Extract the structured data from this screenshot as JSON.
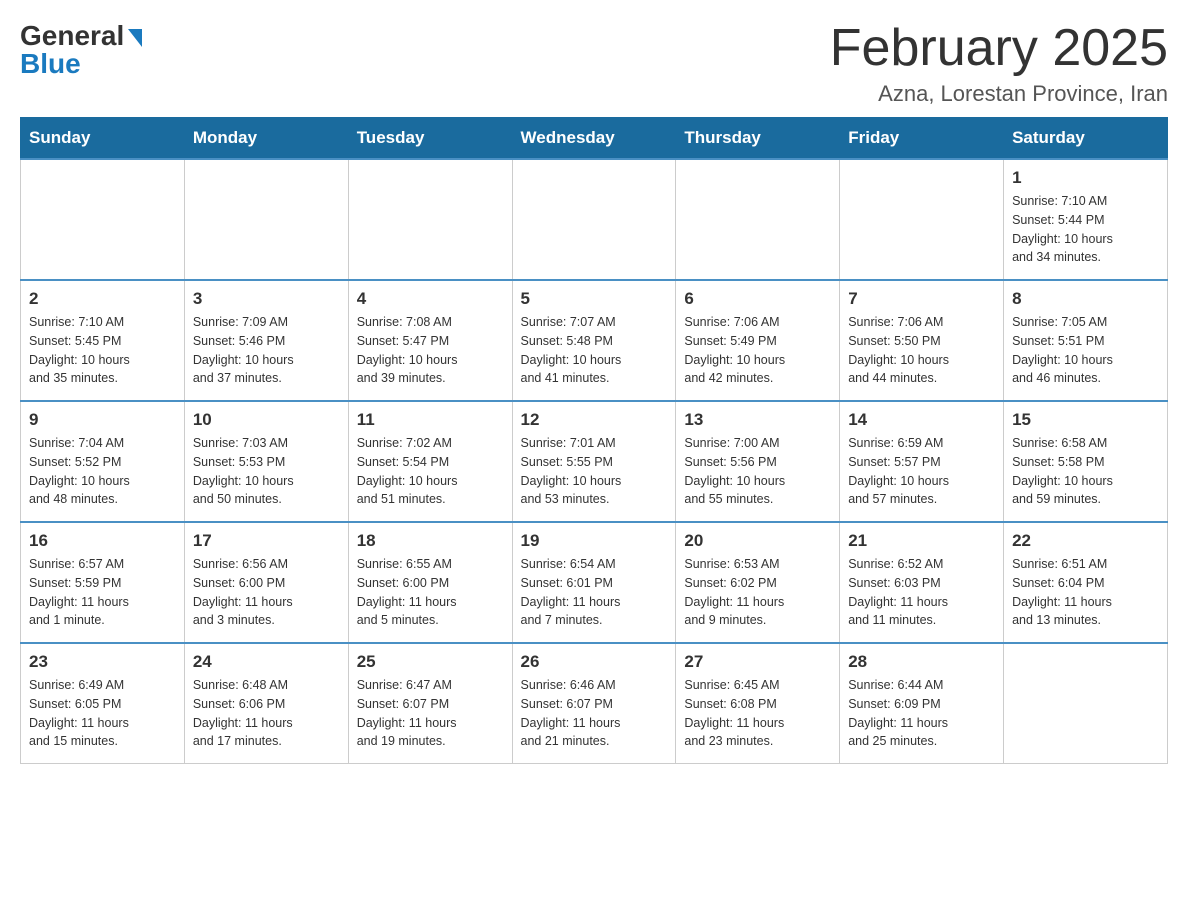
{
  "header": {
    "logo_general": "General",
    "logo_blue": "Blue",
    "month_title": "February 2025",
    "location": "Azna, Lorestan Province, Iran"
  },
  "days_of_week": [
    "Sunday",
    "Monday",
    "Tuesday",
    "Wednesday",
    "Thursday",
    "Friday",
    "Saturday"
  ],
  "weeks": [
    {
      "days": [
        {
          "number": "",
          "info": ""
        },
        {
          "number": "",
          "info": ""
        },
        {
          "number": "",
          "info": ""
        },
        {
          "number": "",
          "info": ""
        },
        {
          "number": "",
          "info": ""
        },
        {
          "number": "",
          "info": ""
        },
        {
          "number": "1",
          "info": "Sunrise: 7:10 AM\nSunset: 5:44 PM\nDaylight: 10 hours\nand 34 minutes."
        }
      ]
    },
    {
      "days": [
        {
          "number": "2",
          "info": "Sunrise: 7:10 AM\nSunset: 5:45 PM\nDaylight: 10 hours\nand 35 minutes."
        },
        {
          "number": "3",
          "info": "Sunrise: 7:09 AM\nSunset: 5:46 PM\nDaylight: 10 hours\nand 37 minutes."
        },
        {
          "number": "4",
          "info": "Sunrise: 7:08 AM\nSunset: 5:47 PM\nDaylight: 10 hours\nand 39 minutes."
        },
        {
          "number": "5",
          "info": "Sunrise: 7:07 AM\nSunset: 5:48 PM\nDaylight: 10 hours\nand 41 minutes."
        },
        {
          "number": "6",
          "info": "Sunrise: 7:06 AM\nSunset: 5:49 PM\nDaylight: 10 hours\nand 42 minutes."
        },
        {
          "number": "7",
          "info": "Sunrise: 7:06 AM\nSunset: 5:50 PM\nDaylight: 10 hours\nand 44 minutes."
        },
        {
          "number": "8",
          "info": "Sunrise: 7:05 AM\nSunset: 5:51 PM\nDaylight: 10 hours\nand 46 minutes."
        }
      ]
    },
    {
      "days": [
        {
          "number": "9",
          "info": "Sunrise: 7:04 AM\nSunset: 5:52 PM\nDaylight: 10 hours\nand 48 minutes."
        },
        {
          "number": "10",
          "info": "Sunrise: 7:03 AM\nSunset: 5:53 PM\nDaylight: 10 hours\nand 50 minutes."
        },
        {
          "number": "11",
          "info": "Sunrise: 7:02 AM\nSunset: 5:54 PM\nDaylight: 10 hours\nand 51 minutes."
        },
        {
          "number": "12",
          "info": "Sunrise: 7:01 AM\nSunset: 5:55 PM\nDaylight: 10 hours\nand 53 minutes."
        },
        {
          "number": "13",
          "info": "Sunrise: 7:00 AM\nSunset: 5:56 PM\nDaylight: 10 hours\nand 55 minutes."
        },
        {
          "number": "14",
          "info": "Sunrise: 6:59 AM\nSunset: 5:57 PM\nDaylight: 10 hours\nand 57 minutes."
        },
        {
          "number": "15",
          "info": "Sunrise: 6:58 AM\nSunset: 5:58 PM\nDaylight: 10 hours\nand 59 minutes."
        }
      ]
    },
    {
      "days": [
        {
          "number": "16",
          "info": "Sunrise: 6:57 AM\nSunset: 5:59 PM\nDaylight: 11 hours\nand 1 minute."
        },
        {
          "number": "17",
          "info": "Sunrise: 6:56 AM\nSunset: 6:00 PM\nDaylight: 11 hours\nand 3 minutes."
        },
        {
          "number": "18",
          "info": "Sunrise: 6:55 AM\nSunset: 6:00 PM\nDaylight: 11 hours\nand 5 minutes."
        },
        {
          "number": "19",
          "info": "Sunrise: 6:54 AM\nSunset: 6:01 PM\nDaylight: 11 hours\nand 7 minutes."
        },
        {
          "number": "20",
          "info": "Sunrise: 6:53 AM\nSunset: 6:02 PM\nDaylight: 11 hours\nand 9 minutes."
        },
        {
          "number": "21",
          "info": "Sunrise: 6:52 AM\nSunset: 6:03 PM\nDaylight: 11 hours\nand 11 minutes."
        },
        {
          "number": "22",
          "info": "Sunrise: 6:51 AM\nSunset: 6:04 PM\nDaylight: 11 hours\nand 13 minutes."
        }
      ]
    },
    {
      "days": [
        {
          "number": "23",
          "info": "Sunrise: 6:49 AM\nSunset: 6:05 PM\nDaylight: 11 hours\nand 15 minutes."
        },
        {
          "number": "24",
          "info": "Sunrise: 6:48 AM\nSunset: 6:06 PM\nDaylight: 11 hours\nand 17 minutes."
        },
        {
          "number": "25",
          "info": "Sunrise: 6:47 AM\nSunset: 6:07 PM\nDaylight: 11 hours\nand 19 minutes."
        },
        {
          "number": "26",
          "info": "Sunrise: 6:46 AM\nSunset: 6:07 PM\nDaylight: 11 hours\nand 21 minutes."
        },
        {
          "number": "27",
          "info": "Sunrise: 6:45 AM\nSunset: 6:08 PM\nDaylight: 11 hours\nand 23 minutes."
        },
        {
          "number": "28",
          "info": "Sunrise: 6:44 AM\nSunset: 6:09 PM\nDaylight: 11 hours\nand 25 minutes."
        },
        {
          "number": "",
          "info": ""
        }
      ]
    }
  ]
}
